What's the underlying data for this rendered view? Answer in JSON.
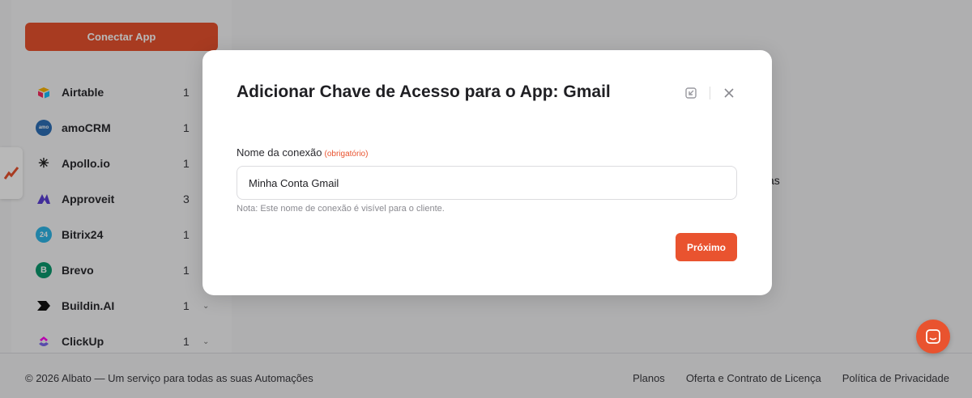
{
  "sidebar": {
    "connect_button": "Conectar App",
    "apps": [
      {
        "name": "Airtable",
        "count": "1",
        "icon": "airtable-icon",
        "color": "#f25c2a",
        "glyph": "",
        "chevron": false
      },
      {
        "name": "amoCRM",
        "count": "1",
        "icon": "amocrm-icon",
        "color": "#2d6fb7",
        "glyph": "amo",
        "chevron": false
      },
      {
        "name": "Apollo.io",
        "count": "1",
        "icon": "apollo-icon",
        "color": "#222222",
        "glyph": "✳",
        "chevron": false
      },
      {
        "name": "Approveit",
        "count": "3",
        "icon": "approveit-icon",
        "color": "#5b3fd6",
        "glyph": "",
        "chevron": false
      },
      {
        "name": "Bitrix24",
        "count": "1",
        "icon": "bitrix24-icon",
        "color": "#2fb6e8",
        "glyph": "24",
        "chevron": false
      },
      {
        "name": "Brevo",
        "count": "1",
        "icon": "brevo-icon",
        "color": "#0b996e",
        "glyph": "B",
        "chevron": false
      },
      {
        "name": "Buildin.AI",
        "count": "1",
        "icon": "buildin-ai-icon",
        "color": "#111111",
        "glyph": "",
        "chevron": true
      },
      {
        "name": "ClickUp",
        "count": "1",
        "icon": "clickup-icon",
        "color": "#7b68ee",
        "glyph": "",
        "chevron": true
      }
    ]
  },
  "background": {
    "fragment_text": "as"
  },
  "modal": {
    "title": "Adicionar Chave de Acesso para o App: Gmail",
    "field_label": "Nome da conexão",
    "required_tag": "(obrigatório)",
    "field_value": "Minha Conta Gmail",
    "note": "Nota: Este nome de conexão é visível para o cliente.",
    "next_button": "Próximo"
  },
  "footer": {
    "copyright": "© 2026 Albato — Um serviço para todas as suas Automações",
    "links": [
      "Planos",
      "Oferta e Contrato de Licença",
      "Política de Privacidade"
    ]
  },
  "colors": {
    "accent": "#e9532f"
  }
}
